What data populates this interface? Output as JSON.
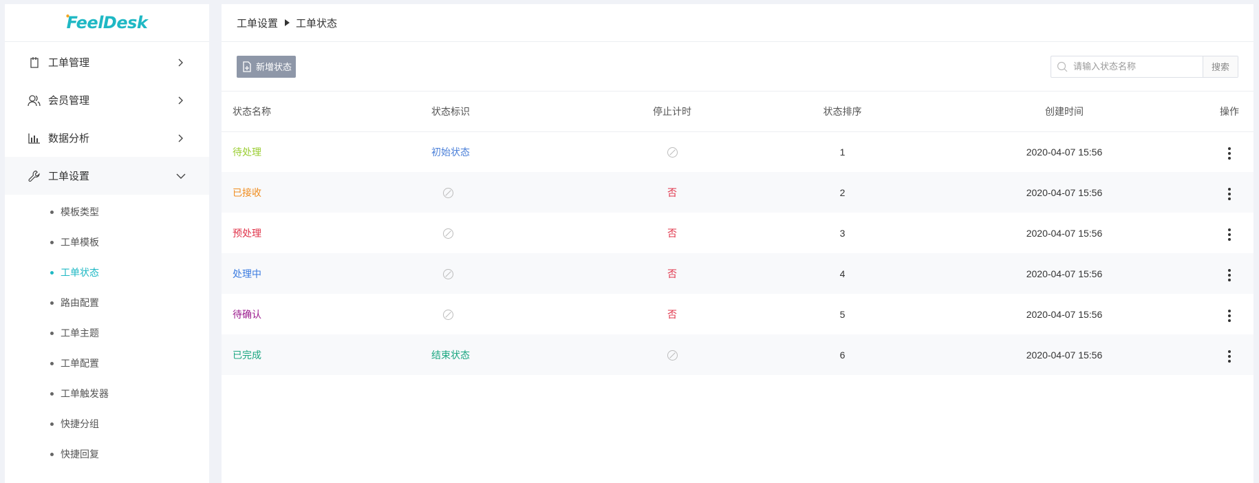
{
  "logo": {
    "text": "FeelDesk"
  },
  "sidebar": {
    "menu": [
      {
        "label": "工单管理",
        "icon": "ticket-icon"
      },
      {
        "label": "会员管理",
        "icon": "users-icon"
      },
      {
        "label": "数据分析",
        "icon": "bar-chart-icon"
      },
      {
        "label": "工单设置",
        "icon": "wrench-icon"
      }
    ],
    "submenu": [
      "模板类型",
      "工单模板",
      "工单状态",
      "路由配置",
      "工单主题",
      "工单配置",
      "工单触发器",
      "快捷分组",
      "快捷回复"
    ],
    "active_sub": "工单状态"
  },
  "breadcrumb": {
    "parent": "工单设置",
    "current": "工单状态"
  },
  "toolbar": {
    "add_label": "新增状态",
    "search_placeholder": "请输入状态名称",
    "search_value": "",
    "search_button": "搜索"
  },
  "table": {
    "headers": [
      "状态名称",
      "状态标识",
      "停止计时",
      "状态排序",
      "创建时间",
      "操作"
    ],
    "rows": [
      {
        "name": "待处理",
        "color": "#9acd32",
        "flag": "初始状态",
        "flag_color": "#4a7fd8",
        "stop": "",
        "sort": "1",
        "time": "2020-04-07 15:56"
      },
      {
        "name": "已接收",
        "color": "#f08c1e",
        "flag": "",
        "flag_color": "",
        "stop": "否",
        "sort": "2",
        "time": "2020-04-07 15:56"
      },
      {
        "name": "预处理",
        "color": "#e0344a",
        "flag": "",
        "flag_color": "",
        "stop": "否",
        "sort": "3",
        "time": "2020-04-07 15:56"
      },
      {
        "name": "处理中",
        "color": "#3a7be0",
        "flag": "",
        "flag_color": "",
        "stop": "否",
        "sort": "4",
        "time": "2020-04-07 15:56"
      },
      {
        "name": "待确认",
        "color": "#9c1d8f",
        "flag": "",
        "flag_color": "",
        "stop": "否",
        "sort": "5",
        "time": "2020-04-07 15:56"
      },
      {
        "name": "已完成",
        "color": "#1aa680",
        "flag": "结束状态",
        "flag_color": "#1aa680",
        "stop": "",
        "sort": "6",
        "time": "2020-04-07 15:56"
      }
    ]
  }
}
